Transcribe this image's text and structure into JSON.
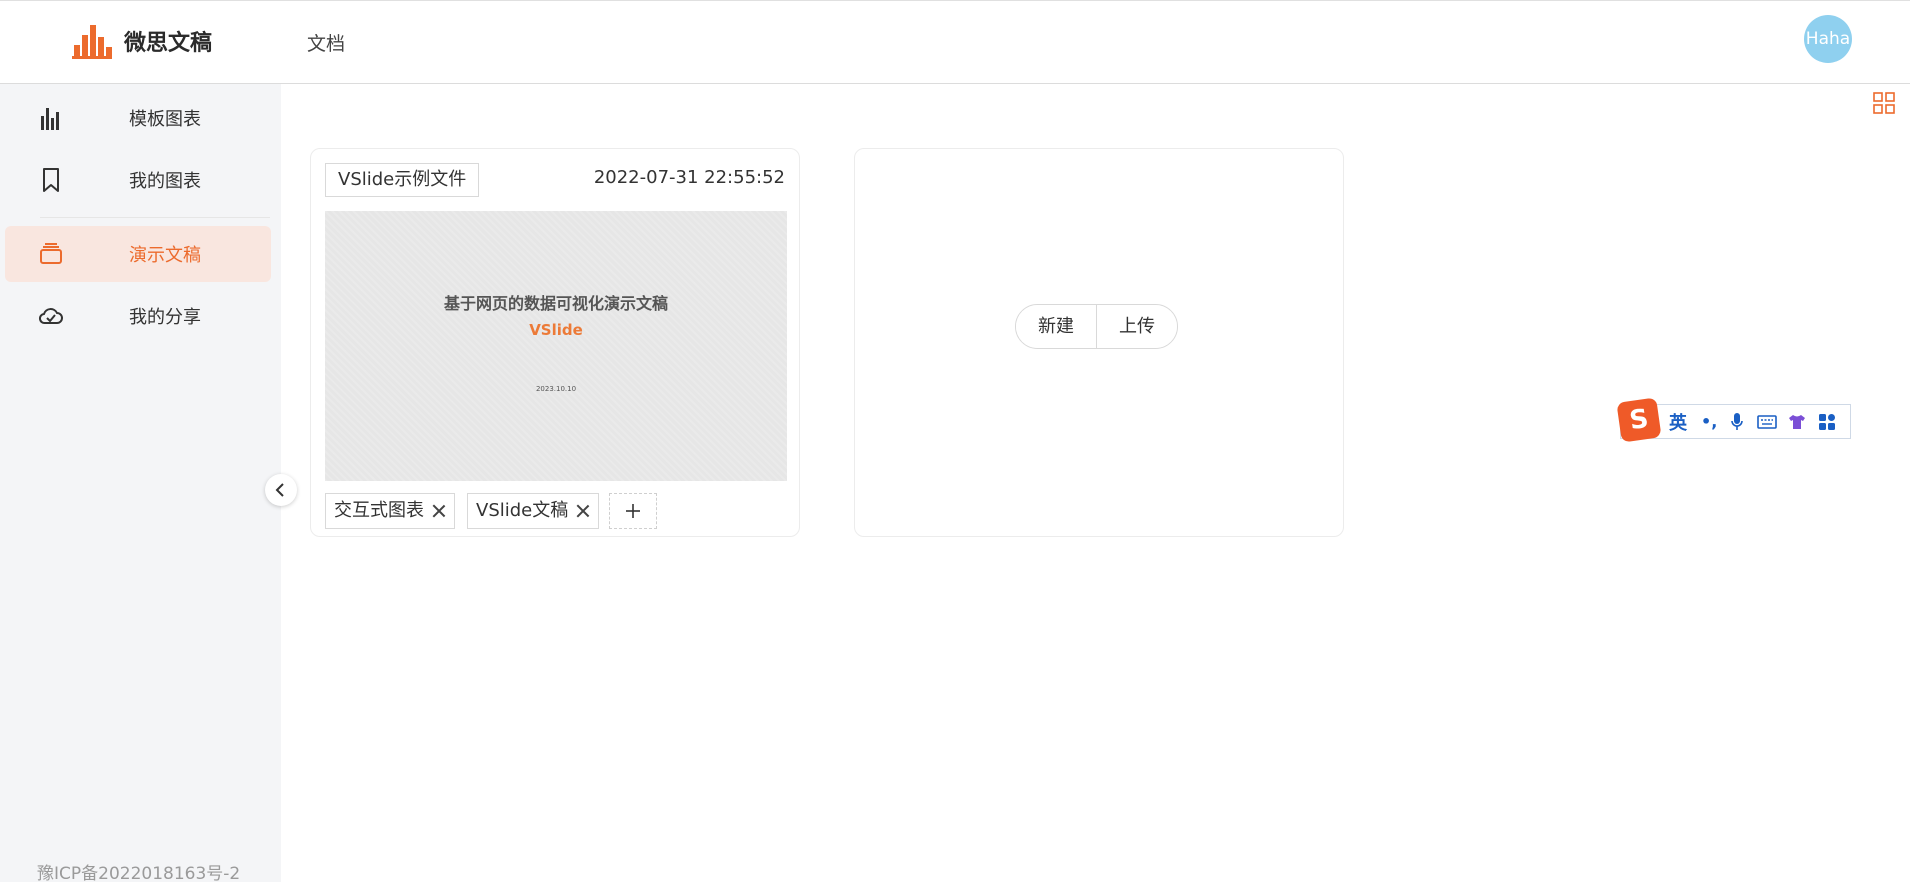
{
  "header": {
    "brand": "微思文稿",
    "nav_docs": "文档",
    "avatar_text": "Haha"
  },
  "sidebar": {
    "items": [
      {
        "label": "模板图表",
        "icon": "bar-chart-icon"
      },
      {
        "label": "我的图表",
        "icon": "bookmark-icon"
      },
      {
        "label": "演示文稿",
        "icon": "layers-icon",
        "active": true
      },
      {
        "label": "我的分享",
        "icon": "cloud-icon"
      }
    ],
    "footer": "豫ICP备2022018163号-2"
  },
  "card": {
    "file_name": "VSlide示例文件",
    "date": "2022-07-31 22:55:52",
    "thumb_title": "基于网页的数据可视化演示文稿",
    "thumb_subtitle": "VSlide",
    "thumb_date": "2023.10.10",
    "tags": [
      "交互式图表",
      "VSlide文稿"
    ]
  },
  "new_card": {
    "new_label": "新建",
    "upload_label": "上传"
  },
  "ime": {
    "logo": "S",
    "lang": "英",
    "punct": "•,"
  },
  "colors": {
    "accent": "#ec6b2d",
    "sidebar_bg": "#f4f5f7",
    "active_bg": "#f9e6df",
    "avatar_bg": "#8fd0ef"
  }
}
